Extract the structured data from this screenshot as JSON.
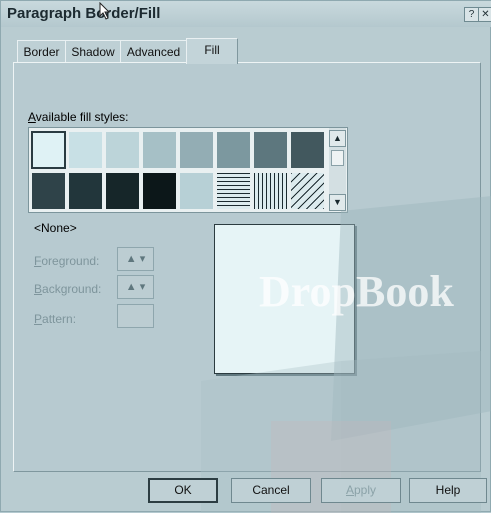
{
  "window": {
    "title": "Paragraph Border/Fill",
    "help": "?",
    "close": "✕"
  },
  "tabs": [
    {
      "label": "Border"
    },
    {
      "label": "Shadow"
    },
    {
      "label": "Advanced"
    },
    {
      "label": "Fill",
      "selected": true
    }
  ],
  "fill": {
    "available_label_prefix": "A",
    "available_label_rest": "vailable fill styles:",
    "selected_style": "<None>",
    "swatches": [
      {
        "name": "none",
        "color": "#dff2f5",
        "selected": true
      },
      {
        "name": "fill-2",
        "color": "#c8e0e5"
      },
      {
        "name": "fill-3",
        "color": "#bcd4d9"
      },
      {
        "name": "fill-4",
        "color": "#a6c0c6"
      },
      {
        "name": "fill-5",
        "color": "#93adb4"
      },
      {
        "name": "fill-6",
        "color": "#7c989f"
      },
      {
        "name": "fill-7",
        "color": "#5d777e"
      },
      {
        "name": "fill-8",
        "color": "#42585e"
      },
      {
        "name": "fill-9",
        "color": "#2f4349"
      },
      {
        "name": "fill-10",
        "color": "#22363b"
      },
      {
        "name": "fill-11",
        "color": "#162629"
      },
      {
        "name": "fill-12",
        "color": "#0c1719"
      },
      {
        "name": "fill-13",
        "color": "#b7d0d6"
      },
      {
        "name": "horizontal-lines",
        "color": "#dcebee",
        "pattern": "horizontal"
      },
      {
        "name": "vertical-lines",
        "color": "#dcebee",
        "pattern": "vertical"
      },
      {
        "name": "diagonal-lines",
        "color": "#dcebee",
        "pattern": "diagonal"
      }
    ],
    "foreground_accel": "F",
    "foreground_rest": "oreground:",
    "background_accel": "B",
    "background_rest": "ackground:",
    "pattern_accel": "P",
    "pattern_rest": "attern:",
    "color_button_icon": "bucket-icon",
    "dropdown_glyph": "▾"
  },
  "buttons": {
    "ok": "OK",
    "cancel": "Cancel",
    "apply_accel": "A",
    "apply_rest": "pply",
    "help": "Help"
  },
  "watermark": {
    "text": "DropBook"
  }
}
